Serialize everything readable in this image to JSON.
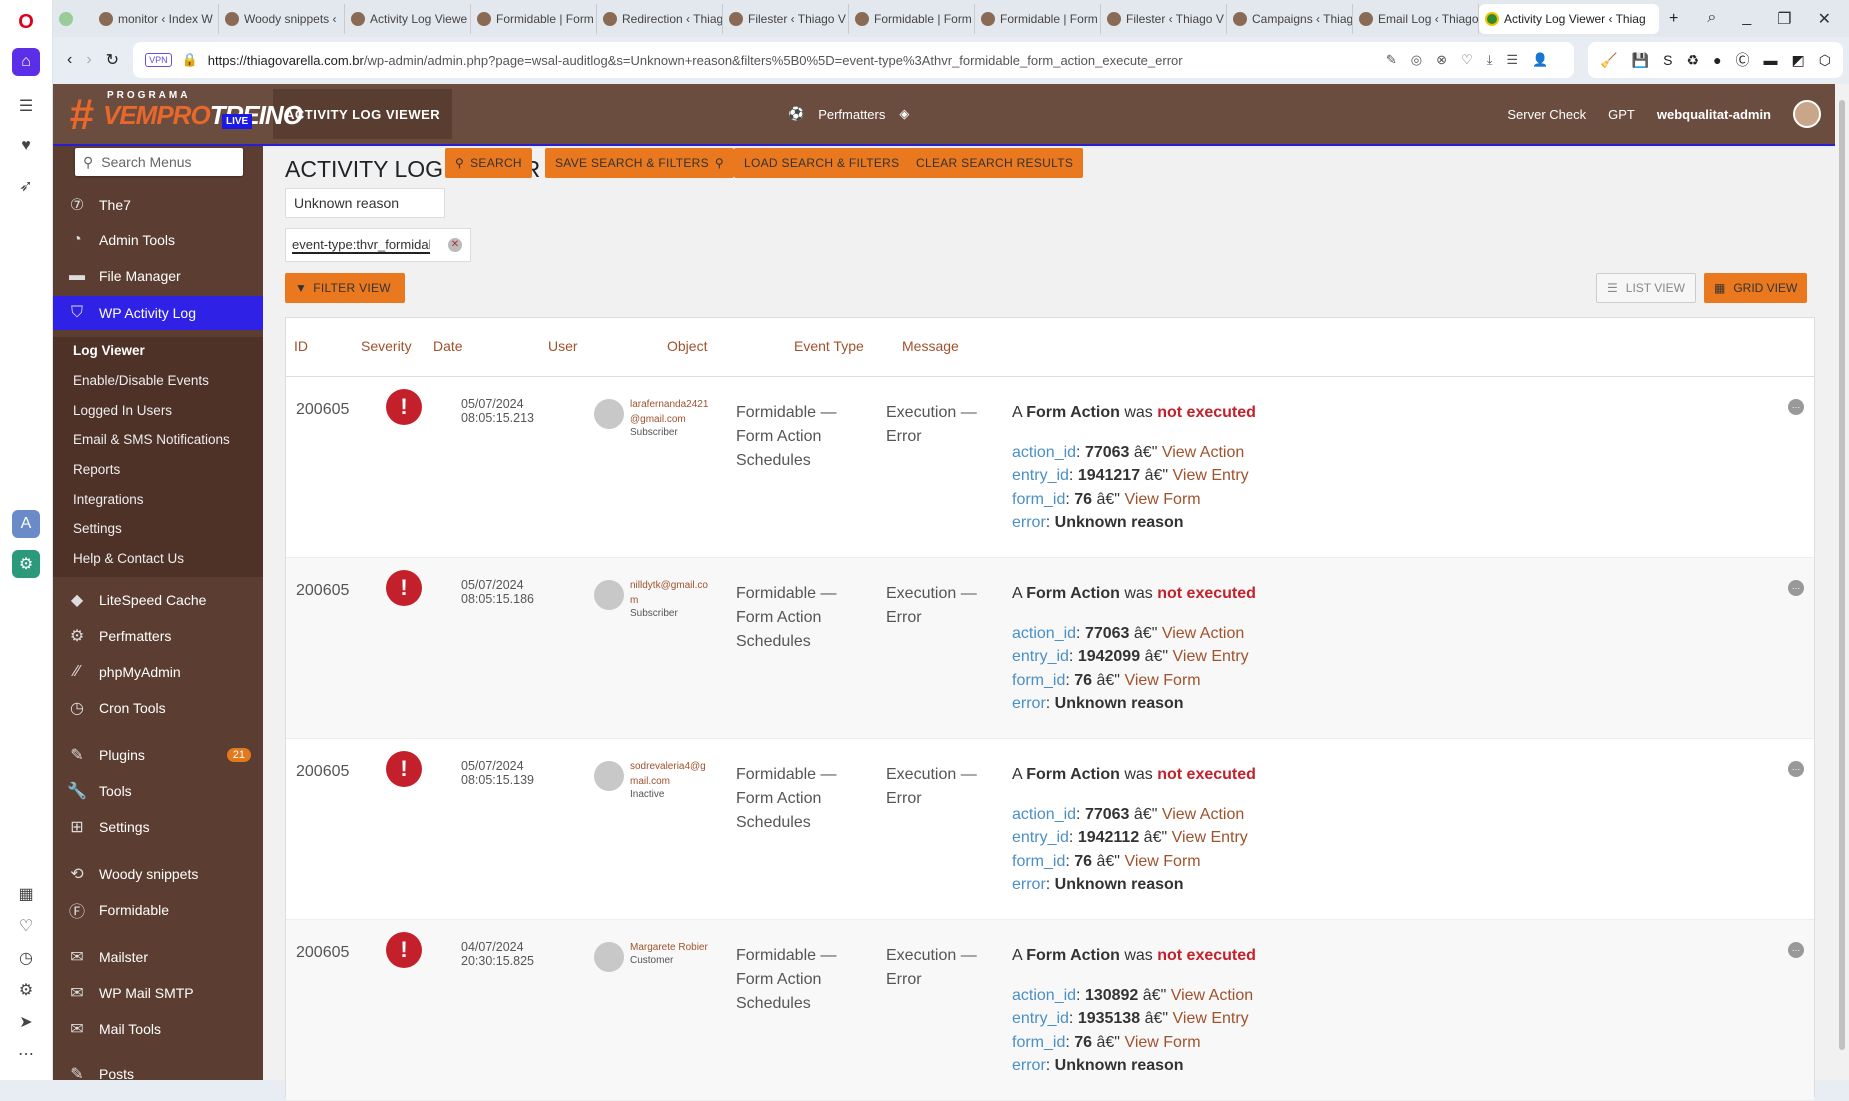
{
  "browser": {
    "tabs": [
      "monitor ‹ Index W",
      "Woody snippets ‹",
      "Activity Log Viewe",
      "Formidable | Form",
      "Redirection ‹ Thiag",
      "Filester ‹ Thiago V",
      "Formidable | Form",
      "Formidable | Form",
      "Filester ‹ Thiago V",
      "Campaigns ‹ Thiag",
      "Email Log ‹ Thiago"
    ],
    "active_tab": "Activity Log Viewer ‹ Thiag",
    "vpn": "VPN",
    "url_host": "https://thiagovarella.com.br",
    "url_path": "/wp-admin/admin.php?page=wsal-auditlog&s=Unknown+reason&filters%5B0%5D=event-type%3Athvr_formidable_form_action_execute_error"
  },
  "header": {
    "logo_top": "PROGRAMA",
    "logo_a": "VEM",
    "logo_b": "PRO",
    "logo_c": "TREINO",
    "logo_live": "LIVE",
    "page_button": "ACTIVITY LOG VIEWER",
    "perfmatters": "Perfmatters",
    "server_check": "Server Check",
    "gpt": "GPT",
    "user": "webqualitat-admin"
  },
  "sidebar": {
    "search_placeholder": "Search Menus",
    "items": [
      {
        "label": "The7",
        "icon": "⑦"
      },
      {
        "label": "Admin Tools",
        "icon": "◔"
      },
      {
        "label": "File Manager",
        "icon": "▬"
      },
      {
        "label": "WP Activity Log",
        "icon": "⛉"
      },
      {
        "label": "LiteSpeed Cache",
        "icon": "◆"
      },
      {
        "label": "Perfmatters",
        "icon": "⚙"
      },
      {
        "label": "phpMyAdmin",
        "icon": "⁄⁄"
      },
      {
        "label": "Cron Tools",
        "icon": "◷"
      },
      {
        "label": "Plugins",
        "icon": "✎"
      },
      {
        "label": "Tools",
        "icon": "🔧"
      },
      {
        "label": "Settings",
        "icon": "⊞"
      },
      {
        "label": "Woody snippets",
        "icon": "⟲"
      },
      {
        "label": "Formidable",
        "icon": "Ⓕ"
      },
      {
        "label": "Mailster",
        "icon": "✉"
      },
      {
        "label": "WP Mail SMTP",
        "icon": "✉"
      },
      {
        "label": "Mail Tools",
        "icon": "✉"
      },
      {
        "label": "Posts",
        "icon": "✎"
      }
    ],
    "plugins_badge": "21",
    "submenu": [
      "Log Viewer",
      "Enable/Disable Events",
      "Logged In Users",
      "Email & SMS Notifications",
      "Reports",
      "Integrations",
      "Settings",
      "Help & Contact Us"
    ]
  },
  "main": {
    "title": "ACTIVITY LOG VIEWER",
    "search_value": "Unknown reason",
    "search_btn": "SEARCH",
    "save_btn": "SAVE SEARCH & FILTERS",
    "load_btn": "LOAD SEARCH & FILTERS",
    "clear_btn": "CLEAR SEARCH RESULTS",
    "filter_chip": "event-type:thvr_formidable_form_action_execute_error",
    "filter_view": "FILTER VIEW",
    "list_view": "LIST VIEW",
    "grid_view": "GRID VIEW",
    "columns": [
      "ID",
      "Severity",
      "Date",
      "User",
      "Object",
      "Event Type",
      "Message"
    ],
    "rows": [
      {
        "id": "200605",
        "date": "05/07/2024",
        "time": "08:05:15.213",
        "user": "larafernanda2421@gmail.com",
        "role": "Subscriber",
        "action_id": "77063",
        "entry_id": "1941217",
        "form_id": "76"
      },
      {
        "id": "200605",
        "date": "05/07/2024",
        "time": "08:05:15.186",
        "user": "nilldytk@gmail.com",
        "role": "Subscriber",
        "action_id": "77063",
        "entry_id": "1942099",
        "form_id": "76"
      },
      {
        "id": "200605",
        "date": "05/07/2024",
        "time": "08:05:15.139",
        "user": "sodrevaleria4@gmail.com",
        "role": "Inactive",
        "action_id": "77063",
        "entry_id": "1942112",
        "form_id": "76"
      },
      {
        "id": "200605",
        "date": "04/07/2024",
        "time": "20:30:15.825",
        "user": "Margarete Robier",
        "role": "Customer",
        "action_id": "130892",
        "entry_id": "1935138",
        "form_id": "76"
      }
    ],
    "obj": [
      "Formidable —",
      "Form Action",
      "Schedules"
    ],
    "event": [
      "Execution —",
      "Error"
    ],
    "msg": {
      "a": "A",
      "form_action": "Form Action",
      "was": "was",
      "not_executed": "not executed",
      "action_key": "action_id",
      "entry_key": "entry_id",
      "form_key": "form_id",
      "error_key": "error",
      "sep": "â€\"",
      "view_action": "View Action",
      "view_entry": "View Entry",
      "view_form": "View Form",
      "error_val": "Unknown reason"
    }
  }
}
